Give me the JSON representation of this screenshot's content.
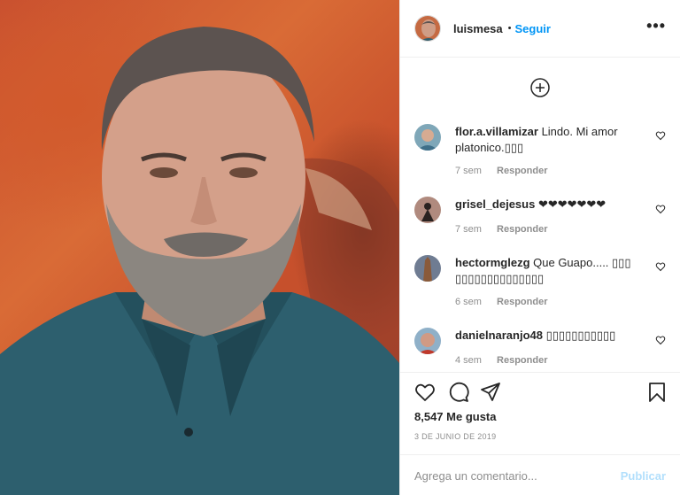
{
  "post": {
    "username": "luismesa",
    "separator": "•",
    "follow_label": "Seguir",
    "more_label": "•••"
  },
  "comments": [
    {
      "user": "flor.a.villamizar",
      "text": "Lindo. Mi amor platonico.▯▯▯",
      "time": "7 sem",
      "reply": "Responder"
    },
    {
      "user": "grisel_dejesus",
      "text": "❤❤❤❤❤❤❤",
      "time": "7 sem",
      "reply": "Responder"
    },
    {
      "user": "hectormglezg",
      "text": "Que Guapo..... ▯▯▯ ▯▯▯▯▯▯▯▯▯▯▯▯▯▯",
      "time": "6 sem",
      "reply": "Responder"
    },
    {
      "user": "danielnaranjo48",
      "text": "▯▯▯▯▯▯▯▯▯▯▯",
      "time": "4 sem",
      "reply": "Responder"
    }
  ],
  "stats": {
    "likes": "8,547 Me gusta",
    "date": "3 DE JUNIO DE 2019"
  },
  "composer": {
    "placeholder": "Agrega un comentario...",
    "publish_label": "Publicar"
  },
  "icons": {
    "like": "heart-icon",
    "comment": "comment-icon",
    "share": "paper-plane-icon",
    "save": "bookmark-icon",
    "load_more": "plus-circle-icon"
  },
  "colors": {
    "accent": "#0095f6",
    "muted": "#8e8e8e",
    "publish_disabled": "#b2dffc"
  }
}
